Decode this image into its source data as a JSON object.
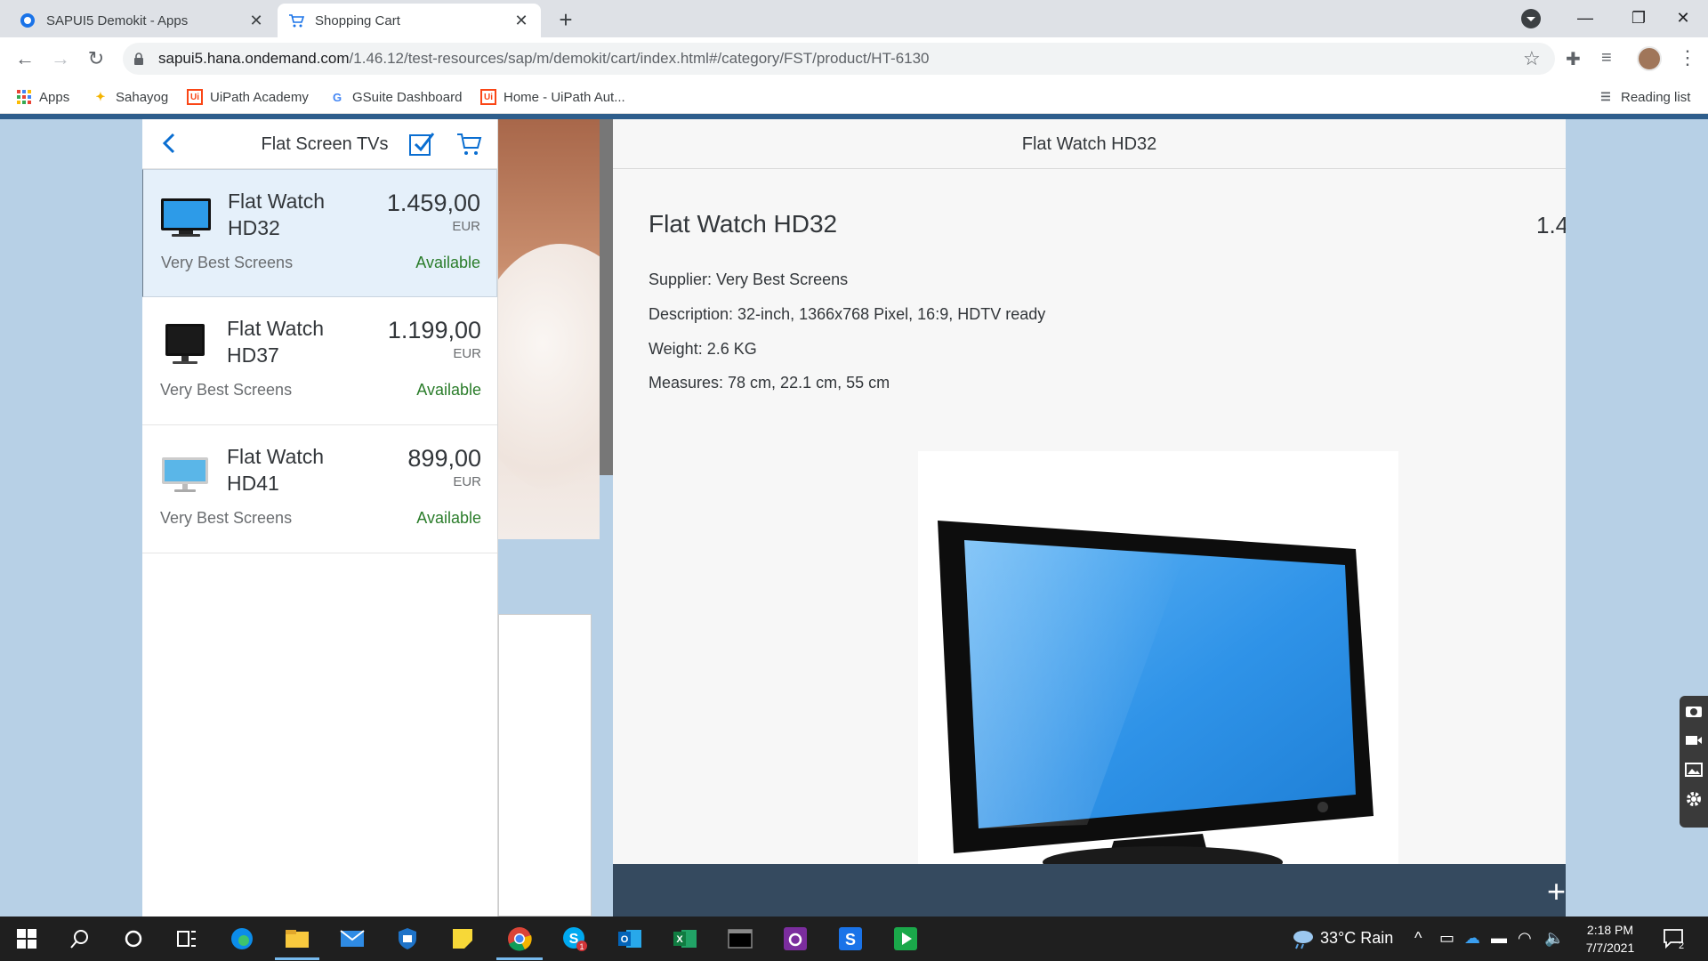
{
  "browser": {
    "tabs": [
      {
        "title": "SAPUI5 Demokit - Apps",
        "active": false
      },
      {
        "title": "Shopping Cart",
        "active": true
      }
    ],
    "close_glyph": "✕",
    "new_tab_glyph": "+",
    "url_host": "sapui5.hana.ondemand.com",
    "url_path": "/1.46.12/test-resources/sap/m/demokit/cart/index.html#/category/FST/product/HT-6130",
    "bookmarks": [
      {
        "label": "Apps",
        "icon": "apps-grid-icon"
      },
      {
        "label": "Sahayog",
        "icon": "sahayog-icon"
      },
      {
        "label": "UiPath Academy",
        "icon": "uipath-icon"
      },
      {
        "label": "GSuite Dashboard",
        "icon": "google-icon"
      },
      {
        "label": "Home - UiPath Aut...",
        "icon": "uipath-icon"
      }
    ],
    "reading_list": "Reading list"
  },
  "master": {
    "title": "Flat Screen TVs",
    "items": [
      {
        "name": "Flat Watch HD32",
        "price": "1.459,00",
        "currency": "EUR",
        "supplier": "Very Best Screens",
        "status": "Available",
        "selected": true
      },
      {
        "name": "Flat Watch HD37",
        "price": "1.199,00",
        "currency": "EUR",
        "supplier": "Very Best Screens",
        "status": "Available",
        "selected": false
      },
      {
        "name": "Flat Watch HD41",
        "price": "899,00",
        "currency": "EUR",
        "supplier": "Very Best Screens",
        "status": "Available",
        "selected": false
      }
    ]
  },
  "detail": {
    "header": "Flat Watch HD32",
    "title": "Flat Watch HD32",
    "price_visible": "1.4",
    "supplier": "Supplier: Very Best Screens",
    "description": "Description: 32-inch, 1366x768 Pixel, 16:9, HDTV ready",
    "weight": "Weight: 2.6 KG",
    "measures": "Measures: 78 cm, 22.1 cm, 55 cm",
    "footer_glyph": "+"
  },
  "taskbar": {
    "weather": "33°C  Rain",
    "time": "2:18 PM",
    "date": "7/7/2021",
    "notifications": "2",
    "skype_badge": "1"
  },
  "colors": {
    "accent": "#0a6ed1",
    "available": "#2b7d2b",
    "footer": "#354a5f",
    "shell_bg": "#b7d0e6"
  }
}
